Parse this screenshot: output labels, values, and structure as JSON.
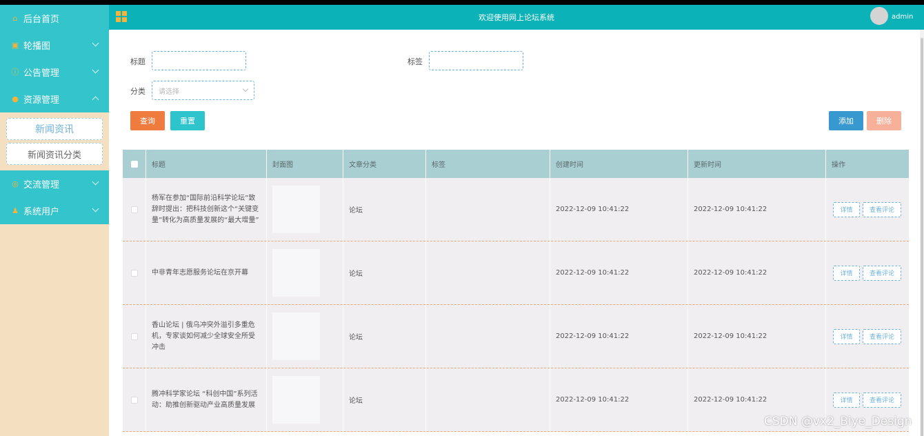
{
  "sidebar": {
    "items": [
      {
        "label": "后台首页",
        "icon": "home-icon",
        "glyph": "⌂"
      },
      {
        "label": "轮播图",
        "icon": "image-icon",
        "glyph": "▣"
      },
      {
        "label": "公告管理",
        "icon": "info-icon",
        "glyph": "ⓘ"
      },
      {
        "label": "资源管理",
        "icon": "location-icon",
        "glyph": "●"
      }
    ],
    "sub_items": [
      {
        "label": "新闻资讯"
      },
      {
        "label": "新闻资讯分类"
      }
    ],
    "bottom_items": [
      {
        "label": "交流管理",
        "icon": "chat-icon",
        "glyph": "◎"
      },
      {
        "label": "系统用户",
        "icon": "user-icon",
        "glyph": "♟"
      }
    ]
  },
  "header": {
    "title": "欢迎使用网上论坛系统",
    "user": "admin"
  },
  "search": {
    "title_label": "标题",
    "tag_label": "标签",
    "category_label": "分类",
    "category_placeholder": "请选择",
    "search_button": "查询",
    "reset_button": "重置",
    "add_button": "添加",
    "delete_button": "删除"
  },
  "table": {
    "headers": [
      "标题",
      "封面图",
      "文章分类",
      "标签",
      "创建时间",
      "更新时间",
      "操作"
    ],
    "detail_label": "详情",
    "comment_label": "查看评论",
    "rows": [
      {
        "title": "杨军在参加“国际前沿科学论坛”致辞时提出：把科技创新这个“关键变量”转化为高质量发展的“最大增量”",
        "category": "论坛",
        "tag": "",
        "created": "2022-12-09 10:41:22",
        "updated": "2022-12-09 10:41:22"
      },
      {
        "title": "中非青年志愿服务论坛在京开幕",
        "category": "论坛",
        "tag": "",
        "created": "2022-12-09 10:41:22",
        "updated": "2022-12-09 10:41:22"
      },
      {
        "title": "香山论坛 | 俄乌冲突外溢引多重危机，专家谈如何减少全球安全所受冲击",
        "category": "论坛",
        "tag": "",
        "created": "2022-12-09 10:41:22",
        "updated": "2022-12-09 10:41:22"
      },
      {
        "title": "腾冲科学家论坛 “科创中国”系列活动：助推创新驱动产业高质量发展",
        "category": "论坛",
        "tag": "",
        "created": "2022-12-09 10:41:22",
        "updated": "2022-12-09 10:41:22"
      }
    ]
  },
  "watermark": "CSDN @vx2_Biye_Design",
  "colors": {
    "sidebar_menu": "#33c4cc",
    "header": "#0bb3b8",
    "accent_orange": "#f07b3f",
    "table_header": "#a9cfd2"
  }
}
